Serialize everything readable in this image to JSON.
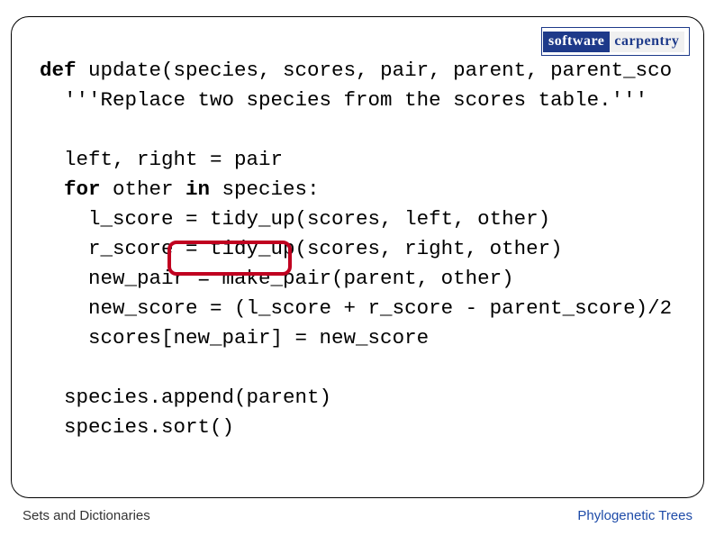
{
  "logo": {
    "left": "software",
    "right": "carpentry"
  },
  "code": {
    "line1_def": "def",
    "line1_rest": " update(species, scores, pair, parent, parent_sco",
    "line2": "  '''Replace two species from the scores table.'''",
    "blank": "",
    "line3": "  left, right = pair",
    "line4_for": "  for",
    "line4_mid": " other ",
    "line4_in": "in",
    "line4_rest": " species:",
    "line5": "    l_score = tidy_up(scores, left, other)",
    "line6": "    r_score = tidy_up(scores, right, other)",
    "line7": "    new_pair = make_pair(parent, other)",
    "line8": "    new_score = (l_score + r_score - parent_score)/2",
    "line9": "    scores[new_pair] = new_score",
    "line10": "  species.append(parent)",
    "line11": "  species.sort()"
  },
  "footer": {
    "left": "Sets and Dictionaries",
    "right": "Phylogenetic Trees"
  },
  "chart_data": null
}
